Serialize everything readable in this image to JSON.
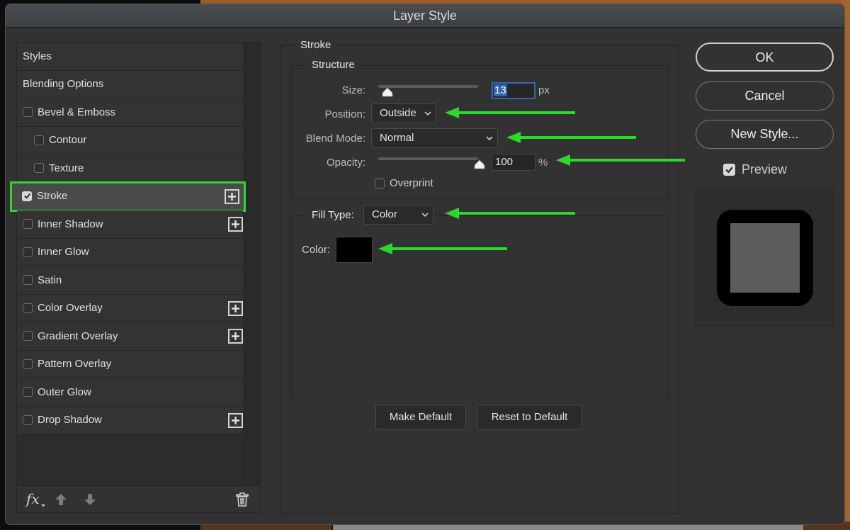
{
  "window": {
    "title": "Layer Style"
  },
  "styles_list": {
    "items": [
      {
        "label": "Styles",
        "checkbox": false,
        "indent": false,
        "checked": false,
        "plus": false,
        "selected": false
      },
      {
        "label": "Blending Options",
        "checkbox": false,
        "indent": false,
        "checked": false,
        "plus": false,
        "selected": false
      },
      {
        "label": "Bevel & Emboss",
        "checkbox": true,
        "indent": false,
        "checked": false,
        "plus": false,
        "selected": false
      },
      {
        "label": "Contour",
        "checkbox": true,
        "indent": true,
        "checked": false,
        "plus": false,
        "selected": false
      },
      {
        "label": "Texture",
        "checkbox": true,
        "indent": true,
        "checked": false,
        "plus": false,
        "selected": false
      },
      {
        "label": "Stroke",
        "checkbox": true,
        "indent": false,
        "checked": true,
        "plus": true,
        "selected": true
      },
      {
        "label": "Inner Shadow",
        "checkbox": true,
        "indent": false,
        "checked": false,
        "plus": true,
        "selected": false
      },
      {
        "label": "Inner Glow",
        "checkbox": true,
        "indent": false,
        "checked": false,
        "plus": false,
        "selected": false
      },
      {
        "label": "Satin",
        "checkbox": true,
        "indent": false,
        "checked": false,
        "plus": false,
        "selected": false
      },
      {
        "label": "Color Overlay",
        "checkbox": true,
        "indent": false,
        "checked": false,
        "plus": true,
        "selected": false
      },
      {
        "label": "Gradient Overlay",
        "checkbox": true,
        "indent": false,
        "checked": false,
        "plus": true,
        "selected": false
      },
      {
        "label": "Pattern Overlay",
        "checkbox": true,
        "indent": false,
        "checked": false,
        "plus": false,
        "selected": false
      },
      {
        "label": "Outer Glow",
        "checkbox": true,
        "indent": false,
        "checked": false,
        "plus": false,
        "selected": false
      },
      {
        "label": "Drop Shadow",
        "checkbox": true,
        "indent": false,
        "checked": false,
        "plus": true,
        "selected": false
      }
    ],
    "footer": {
      "fx_label": "fx"
    }
  },
  "stroke": {
    "section_title": "Stroke",
    "structure": {
      "title": "Structure",
      "size": {
        "label": "Size:",
        "value": "13",
        "unit": "px",
        "slider_fraction": 0.052
      },
      "position": {
        "label": "Position:",
        "value": "Outside"
      },
      "blend_mode": {
        "label": "Blend Mode:",
        "value": "Normal"
      },
      "opacity": {
        "label": "Opacity:",
        "value": "100",
        "unit": "%",
        "slider_fraction": 1.0
      },
      "overprint": {
        "label": "Overprint",
        "checked": false
      }
    },
    "fill": {
      "type_label": "Fill Type:",
      "type_value": "Color",
      "color_label": "Color:",
      "color_value": "#000000"
    },
    "make_default_label": "Make Default",
    "reset_default_label": "Reset to Default"
  },
  "actions": {
    "ok_label": "OK",
    "cancel_label": "Cancel",
    "new_style_label": "New Style...",
    "preview_label": "Preview",
    "preview_checked": true
  },
  "colors": {
    "annotation": "#2fd62b",
    "selection_highlight": "#2e63ad",
    "stroke_color": "#000000",
    "preview_fill": "#5b5b5b"
  }
}
